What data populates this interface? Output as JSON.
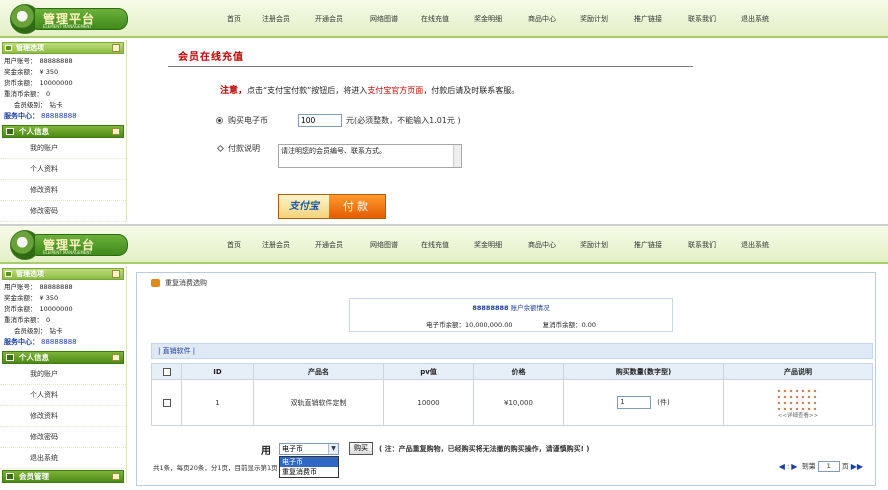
{
  "logo": {
    "title": "管理平台",
    "subtitle": "ELEMENT MANAGEMENT"
  },
  "nav": [
    "首页",
    "注册会员",
    "开通会员",
    "网络图谱",
    "在线充值",
    "奖金明细",
    "商品中心",
    "奖励计划",
    "推广链接",
    "联系我们",
    "退出系统"
  ],
  "sidebar": {
    "head": "管理选项",
    "info": [
      {
        "label": "用户账号：",
        "value": "88888888"
      },
      {
        "label": "奖金余额：",
        "value": "¥ 350"
      },
      {
        "label": "货币余额：",
        "value": "10000000"
      },
      {
        "label": "重消币余额：",
        "value": "0"
      },
      {
        "label": "会员级别：",
        "value": "钻卡"
      }
    ],
    "service_label": "服务中心：",
    "service_value": "88888888",
    "section1": "个人信息",
    "menu_top": [
      "我的账户",
      "个人资料",
      "修改资料",
      "修改密码"
    ],
    "menu_bottom": [
      "我的账户",
      "个人资料",
      "修改资料",
      "修改密码",
      "退出系统"
    ],
    "section2": "会员管理"
  },
  "recharge": {
    "title": "会员在线充值",
    "notice_label": "注意，",
    "notice_a": "点击“支付宝付款”按钮后，将进入",
    "notice_link": "支付宝官方页面",
    "notice_b": "，付款后请及时联系客服。",
    "amount_label": "购买电子币",
    "amount_value": "100",
    "amount_hint": "元(必须整数，不能输入1.01元 )",
    "note_label": "付款说明",
    "note_value": "请注明您的会员编号、联系方式。",
    "pay_logo": "支付宝",
    "pay_text": "付款"
  },
  "shop": {
    "title": "重复消费选购",
    "balance_account": "88888888",
    "balance_head": "账户余额情况",
    "balance_e": "电子币余额：10,000,000.00",
    "balance_r": "复消币余额：0.00",
    "category": "| 直销软件 |",
    "headers": [
      "",
      "ID",
      "产品名",
      "pv值",
      "价格",
      "购买数量(数字型)",
      "产品说明"
    ],
    "rows": [
      {
        "id": "1",
        "name": "双轨直销软件定制",
        "pv": "10000",
        "price": "¥10,000",
        "qty": "1",
        "unit": "(件)",
        "desc": "<<详细查看>>"
      }
    ],
    "use_label": "用",
    "select_value": "电子币",
    "options": [
      "电子币",
      "重复消费币"
    ],
    "buy_label": "购买",
    "buy_note": "( 注：产品重复购物，已经购买将无法撤的购买操作，请谨慎购买! )",
    "pager_left": "共1条，每页20条，分1页，目前显示第1页",
    "pager_goto": "到第",
    "pager_page": "1",
    "pager_unit": "页"
  }
}
